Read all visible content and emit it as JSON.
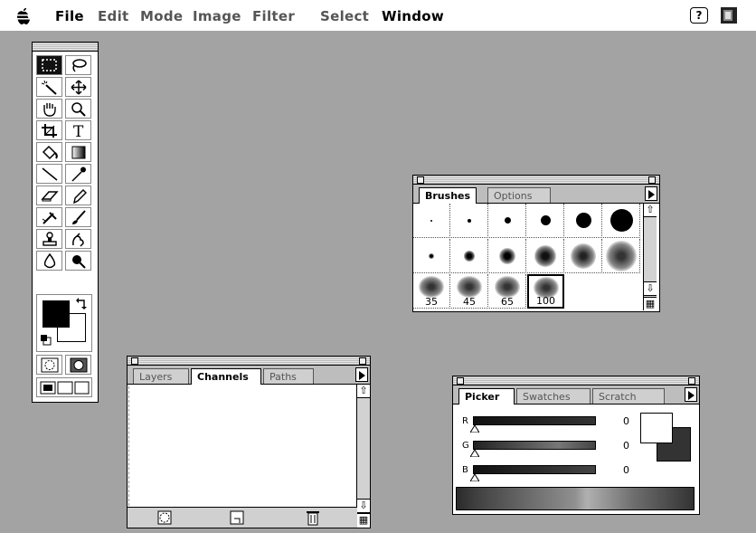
{
  "menubar": {
    "items": [
      "File",
      "Edit",
      "Mode",
      "Image",
      "Filter",
      "Select",
      "Window"
    ],
    "icons": [
      "apple-icon",
      "help-icon",
      "application-icon"
    ]
  },
  "toolbox": {
    "tools": [
      "marquee-tool",
      "lasso-tool",
      "magic-wand-tool",
      "move-tool",
      "hand-tool",
      "zoom-tool",
      "crop-tool",
      "type-tool",
      "paint-bucket-tool",
      "gradient-tool",
      "line-tool",
      "eyedropper-tool",
      "eraser-tool",
      "pencil-tool",
      "airbrush-tool",
      "paintbrush-tool",
      "rubber-stamp-tool",
      "smudge-tool",
      "blur-tool",
      "burn-tool"
    ],
    "selected_tool": "marquee-tool"
  },
  "brushes": {
    "tabs": [
      "Brushes",
      "Options"
    ],
    "active_tab": "Brushes",
    "size_labels": [
      "35",
      "45",
      "65",
      "100"
    ],
    "selected": "100"
  },
  "channels": {
    "tabs": [
      "Layers",
      "Channels",
      "Paths"
    ],
    "active_tab": "Channels"
  },
  "picker": {
    "tabs": [
      "Picker",
      "Swatches",
      "Scratch"
    ],
    "active_tab": "Picker",
    "sliders": [
      {
        "label": "R",
        "value": "0"
      },
      {
        "label": "G",
        "value": "0"
      },
      {
        "label": "B",
        "value": "0"
      }
    ]
  }
}
